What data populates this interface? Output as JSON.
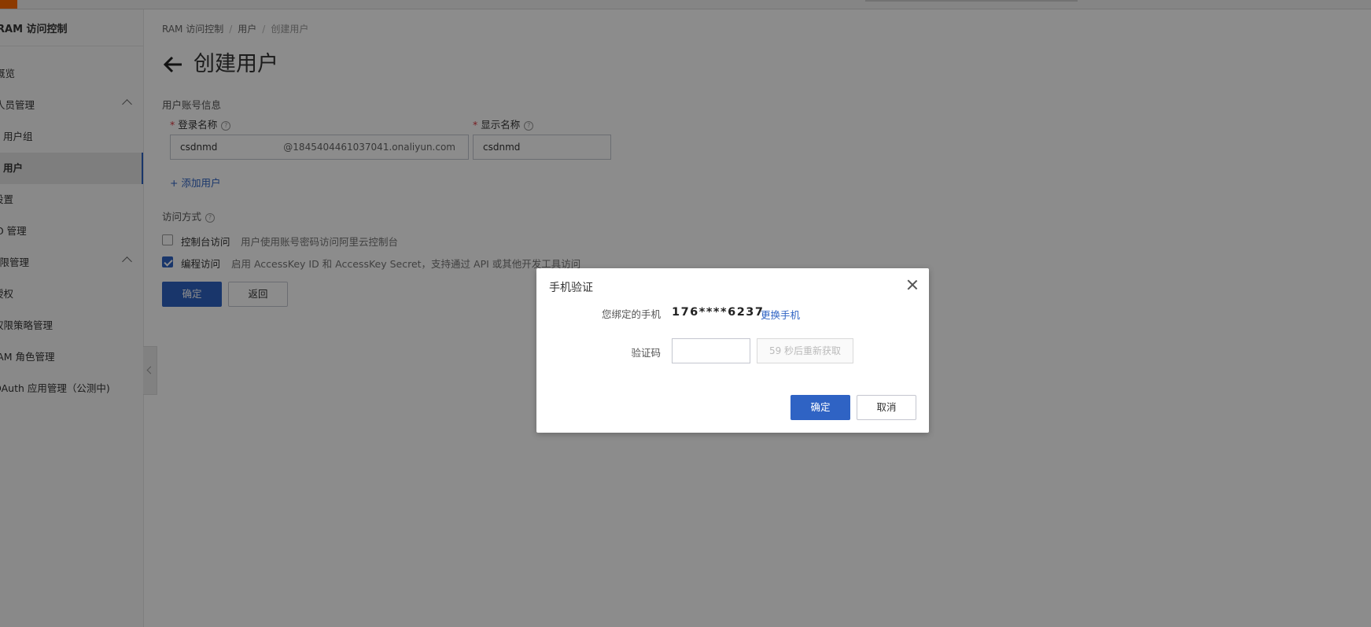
{
  "sidebar": {
    "title": "RAM 访问控制",
    "items": [
      {
        "label": "概览"
      },
      {
        "label": "人员管理"
      },
      {
        "label": "用户组"
      },
      {
        "label": "用户"
      },
      {
        "label": "设置"
      },
      {
        "label": "SSO 管理"
      },
      {
        "label": "权限管理"
      },
      {
        "label": "授权"
      },
      {
        "label": "权限策略管理"
      },
      {
        "label": "RAM 角色管理"
      },
      {
        "label": "OAuth 应用管理（公测中)"
      }
    ]
  },
  "breadcrumb": [
    "RAM 访问控制",
    "用户",
    "创建用户"
  ],
  "page": {
    "title": "创建用户",
    "account_section": "用户账号信息",
    "login_name_label": "登录名称",
    "display_name_label": "显示名称",
    "login_name_value": "csdnmd",
    "login_name_suffix": "@1845404461037041.onaliyun.com",
    "display_name_value": "csdnmd",
    "add_user": "+ 添加用户",
    "access_section": "访问方式",
    "help_glyph": "?",
    "console_access": {
      "label": "控制台访问",
      "desc": "用户使用账号密码访问阿里云控制台",
      "checked": false
    },
    "api_access": {
      "label": "编程访问",
      "desc": "启用 AccessKey ID 和 AccessKey Secret，支持通过 API 或其他开发工具访问",
      "checked": true
    },
    "confirm": "确定",
    "back": "返回"
  },
  "dialog": {
    "title": "手机验证",
    "phone_label": "您绑定的手机",
    "phone_value": "176****6237",
    "change_phone": "更换手机",
    "code_label": "验证码",
    "code_value": "",
    "resend": "59 秒后重新获取",
    "confirm": "确定",
    "cancel": "取消"
  },
  "colors": {
    "primary": "#2f63c4",
    "overlay": "rgba(0,0,0,0.45)",
    "required": "#d9363e"
  }
}
